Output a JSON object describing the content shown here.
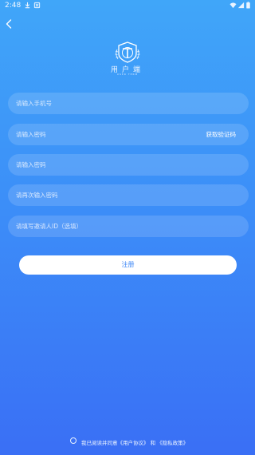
{
  "status_bar": {
    "time": "2:48",
    "icons": [
      "download-icon",
      "app-notification-icon",
      "wifi-icon",
      "signal-icon",
      "battery-icon"
    ]
  },
  "nav": {
    "back_icon": "chevron-left-icon"
  },
  "brand": {
    "name": "用户端",
    "subtitle": "USER TERM"
  },
  "form": {
    "phone_placeholder": "请输入手机号",
    "code_placeholder": "请输入密码",
    "get_code_label": "获取验证码",
    "password_placeholder": "请输入密码",
    "confirm_placeholder": "请再次输入密码",
    "invite_placeholder": "请填写邀请人ID（选填）",
    "submit_label": "注册"
  },
  "agreement": {
    "prefix": "我已阅读并同意",
    "user_agreement": "《用户协议》",
    "conjunction": "和",
    "privacy_policy": "《隐私政策》"
  },
  "colors": {
    "gradient_top": "#40a6f9",
    "gradient_bottom": "#3a6ff5",
    "button_text": "#3b86f6"
  }
}
